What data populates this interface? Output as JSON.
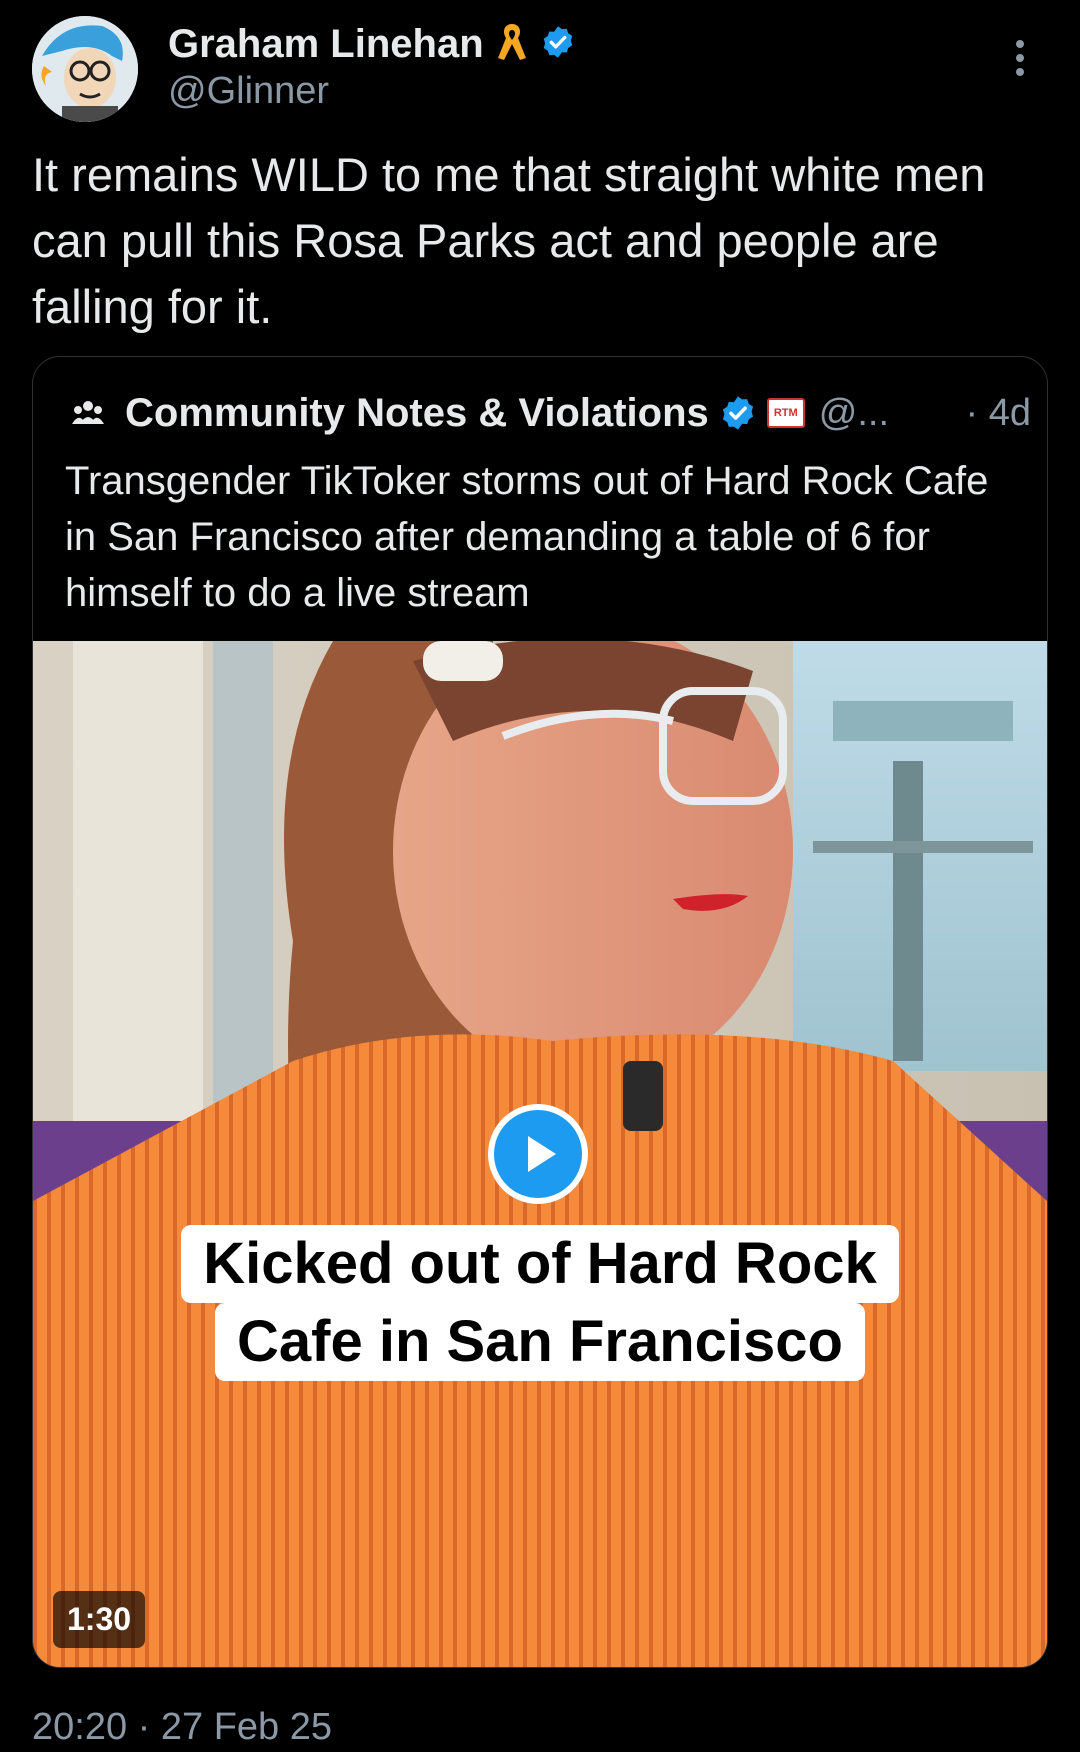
{
  "author": {
    "display_name": "Graham Linehan",
    "handle": "@Glinner"
  },
  "tweet": {
    "text": "It remains WILD to me that straight white men can pull this Rosa Parks act and people are falling for it.",
    "timestamp": "20:20 · 27 Feb 25"
  },
  "quote": {
    "name": "Community Notes & Violations",
    "badge_text": "RTM",
    "handle": "@...",
    "age": "· 4d",
    "text": "Transgender TikToker storms out of Hard Rock Cafe in San Francisco after demanding a table of 6 for himself to do a live stream",
    "media": {
      "caption_line1": "Kicked out of Hard Rock",
      "caption_line2": "Cafe in San Francisco",
      "duration": "1:30"
    }
  },
  "icons": {
    "verified": "verified-badge-icon",
    "awareness_ribbon": "ribbon-icon",
    "more": "more-vertical-icon",
    "community": "community-icon",
    "play": "play-icon"
  },
  "colors": {
    "background": "#000000",
    "text": "#e7e9ea",
    "muted": "#8b98a5",
    "verified": "#1d9bf0",
    "ribbon": "#f5a623",
    "border": "#2f3336"
  }
}
